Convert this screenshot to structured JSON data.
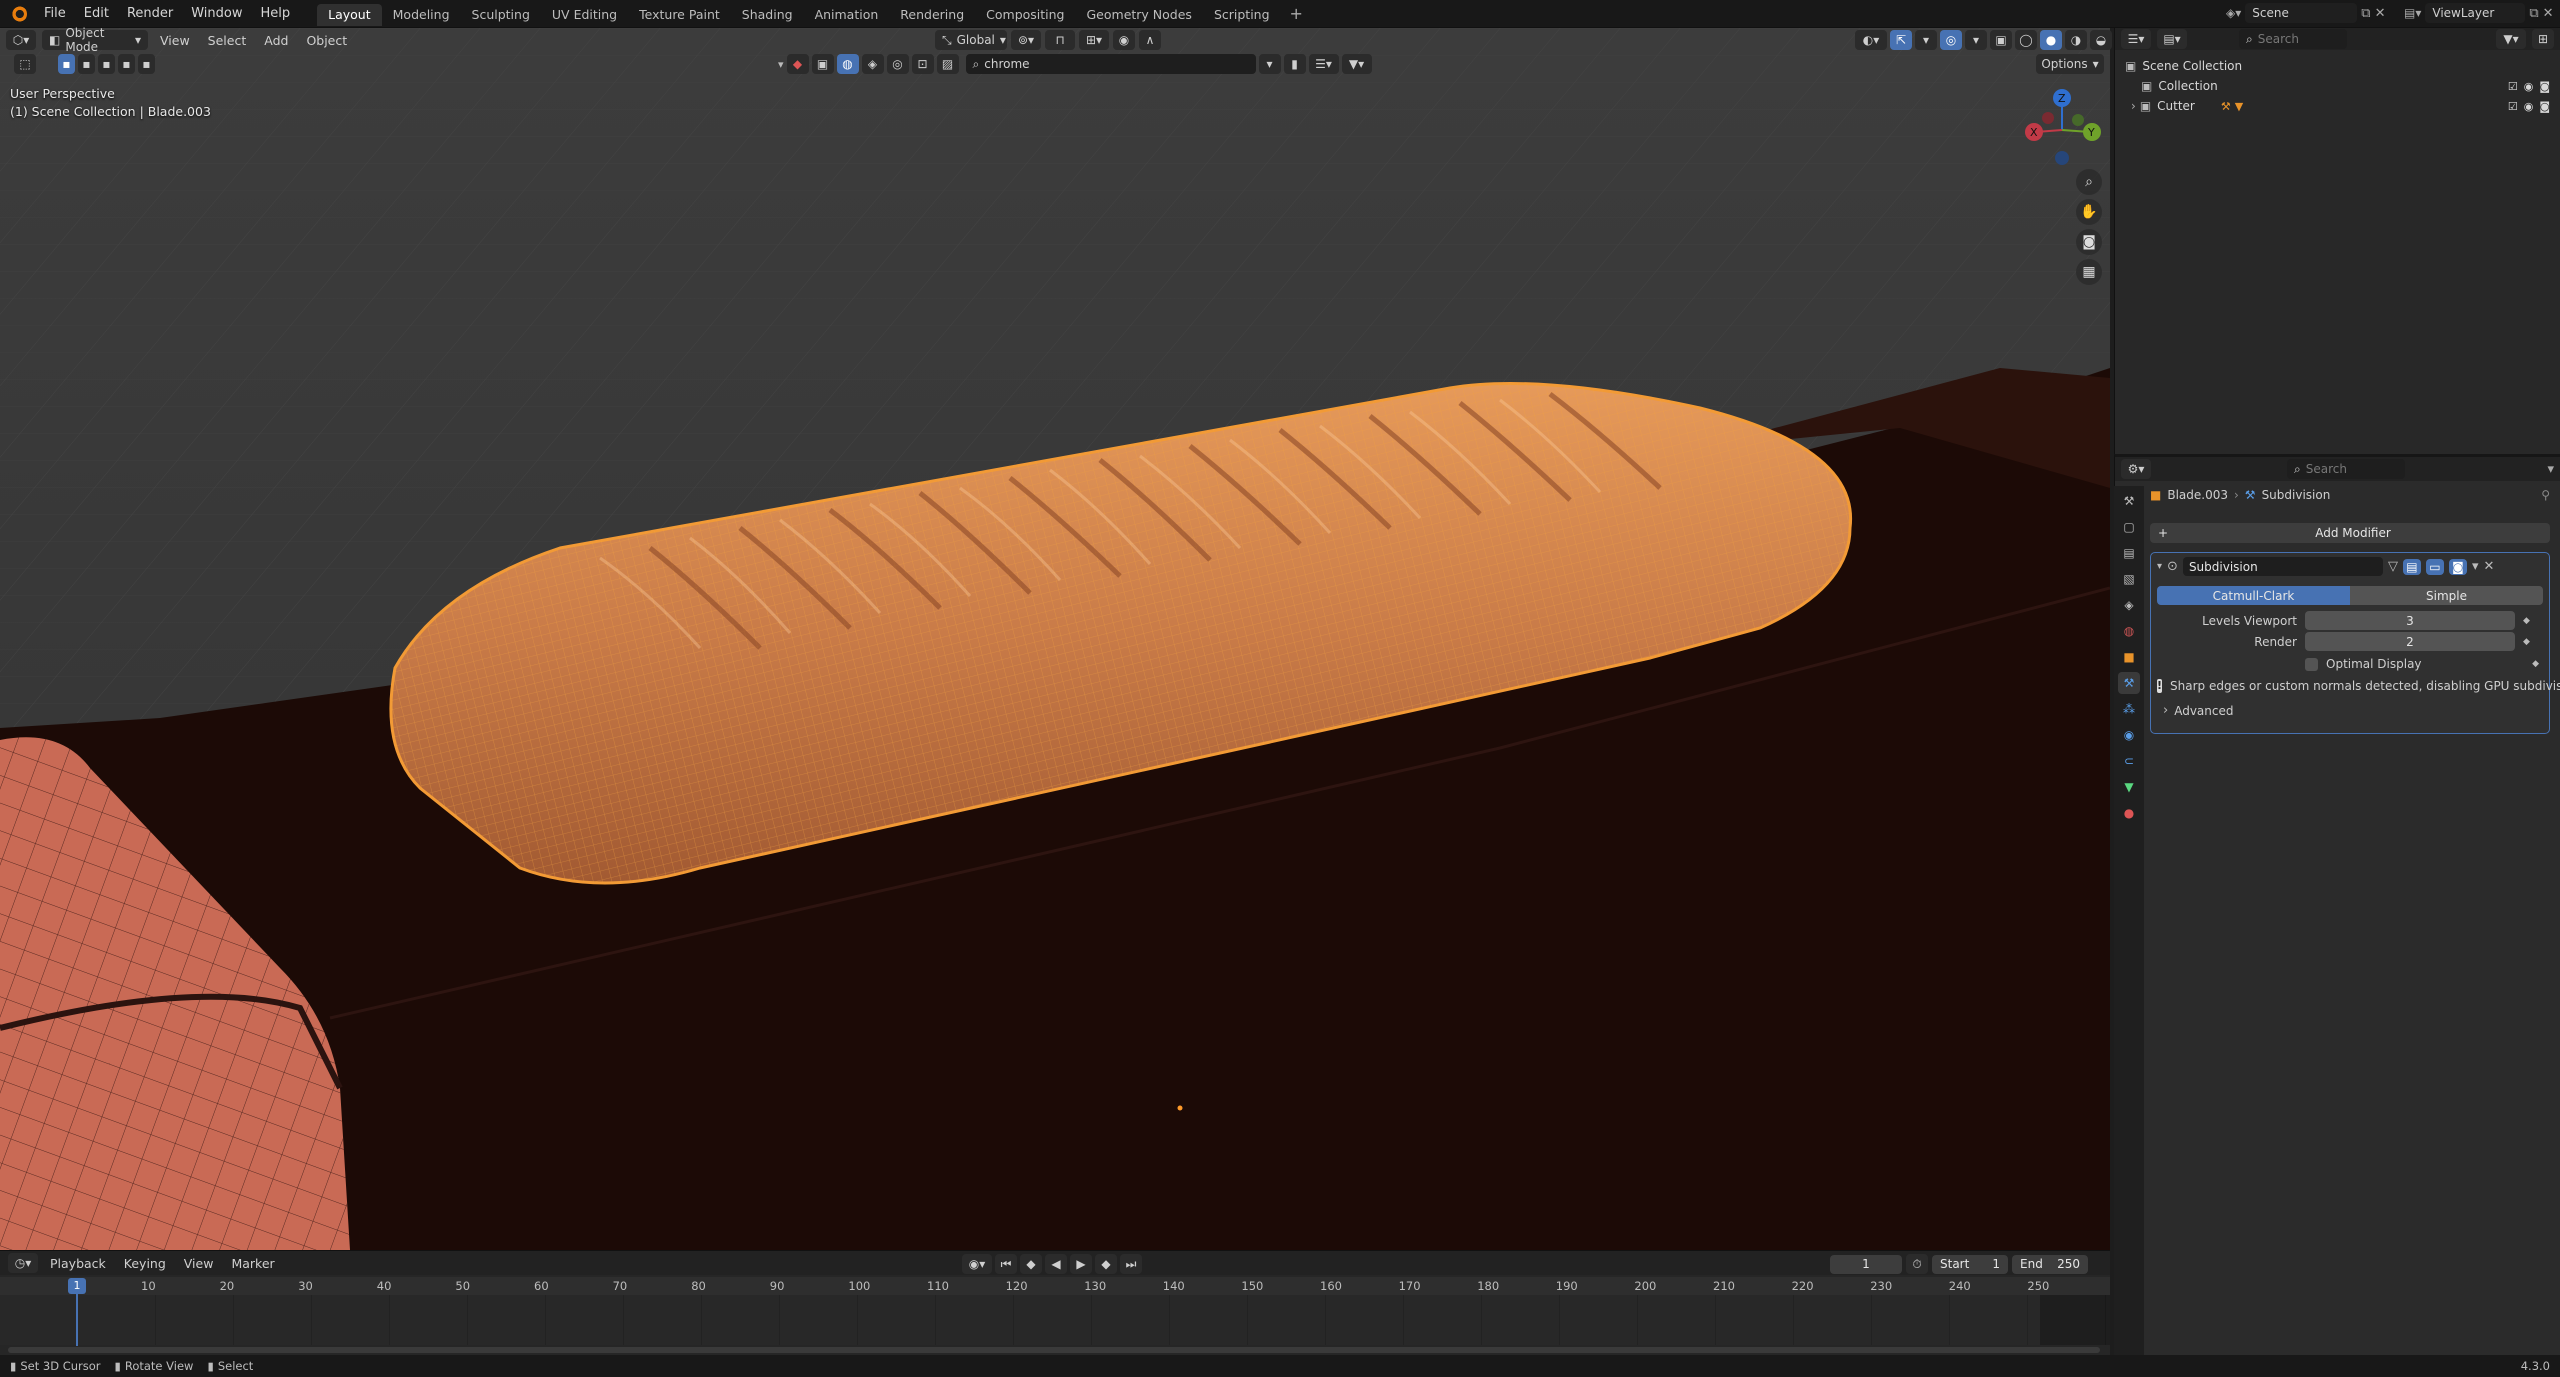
{
  "app": {
    "menus": [
      "File",
      "Edit",
      "Render",
      "Window",
      "Help"
    ],
    "workspaces": [
      "Layout",
      "Modeling",
      "Sculpting",
      "UV Editing",
      "Texture Paint",
      "Shading",
      "Animation",
      "Rendering",
      "Compositing",
      "Geometry Nodes",
      "Scripting"
    ],
    "active_workspace": "Layout",
    "scene_name": "Scene",
    "view_layer": "ViewLayer",
    "version": "4.3.0"
  },
  "viewport": {
    "mode": "Object Mode",
    "menus": [
      "View",
      "Select",
      "Add",
      "Object"
    ],
    "orientation": "Global",
    "search_filter": "chrome",
    "options_label": "Options",
    "overlay_line1": "User Perspective",
    "overlay_line2": "(1) Scene Collection | Blade.003",
    "gizmo": {
      "x": "X",
      "y": "Y",
      "z": "Z"
    },
    "accent_color": "#e8932a",
    "mesh_color": "#c96a55"
  },
  "outliner": {
    "search_placeholder": "Search",
    "root": "Scene Collection",
    "items": [
      {
        "name": "Collection"
      },
      {
        "name": "Cutter"
      }
    ]
  },
  "properties": {
    "search_placeholder": "Search",
    "breadcrumb_object": "Blade.003",
    "breadcrumb_modifier": "Subdivision",
    "add_modifier_label": "Add Modifier",
    "modifier": {
      "name": "Subdivision",
      "algorithm_options": [
        "Catmull-Clark",
        "Simple"
      ],
      "selected_algorithm": "Catmull-Clark",
      "levels_viewport_label": "Levels Viewport",
      "levels_viewport": "3",
      "render_label": "Render",
      "render": "2",
      "optimal_display_label": "Optimal Display",
      "warning": "Sharp edges or custom normals detected, disabling GPU subdivis...",
      "advanced_label": "Advanced"
    }
  },
  "timeline": {
    "menus": [
      "Playback",
      "Keying",
      "View",
      "Marker"
    ],
    "current_frame": "1",
    "start_label": "Start",
    "start": "1",
    "end_label": "End",
    "end": "250",
    "ruler": [
      "10",
      "20",
      "30",
      "40",
      "50",
      "60",
      "70",
      "80",
      "90",
      "100",
      "110",
      "120",
      "130",
      "140",
      "150",
      "160",
      "170",
      "180",
      "190",
      "200",
      "210",
      "220",
      "230",
      "240",
      "250"
    ],
    "playhead_label": "1"
  },
  "status": {
    "hints": [
      "Set 3D Cursor",
      "Rotate View",
      "Select"
    ]
  }
}
